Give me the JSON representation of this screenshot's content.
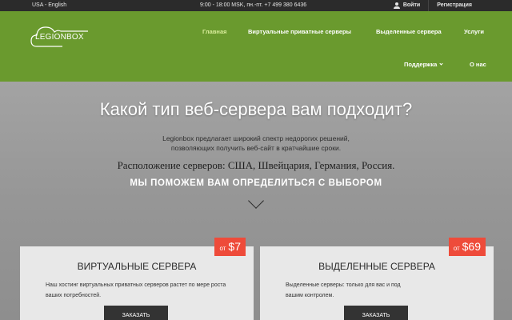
{
  "topbar": {
    "language": "USA - English",
    "hours": "9:00 - 18:00 MSK, пн.-пт.",
    "phone": "+7 499 380 6436",
    "login": "Войти",
    "register": "Регистрация"
  },
  "logo": {
    "text": "LEGIONBOX"
  },
  "nav": {
    "items": [
      {
        "label": "Главная"
      },
      {
        "label": "Виртуальные приватные серверы"
      },
      {
        "label": "Выделенные сервера"
      },
      {
        "label": "Услуги"
      },
      {
        "label": "Поддержка"
      },
      {
        "label": "О нас"
      }
    ]
  },
  "hero": {
    "title": "Какой тип веб-сервера вам подходит?",
    "description_line1": "Legionbox предлагает широкий спектр недорогих решений,",
    "description_line2": "позволяющих получить веб-сайт в кратчайшие сроки.",
    "locations": "Расположение серверов: США, Швейцария, Германия, Россия.",
    "help": "МЫ ПОМОЖЕМ ВАМ ОПРЕДЕЛИТЬСЯ С ВЫБОРОМ"
  },
  "cards": [
    {
      "price_prefix": "от",
      "price": "$7",
      "title": "ВИРТУАЛЬНЫЕ СЕРВЕРА",
      "text": "Наш хостинг виртуальных приватных серверов растет по мере роста ваших потребностей.",
      "button": "ЗАКАЗАТЬ"
    },
    {
      "price_prefix": "от",
      "price": "$69",
      "title": "ВЫДЕЛЕННЫЕ СЕРВЕРА",
      "text": "Выделенные серверы: только для вас и под вашим контролем.",
      "button": "ЗАКАЗАТЬ"
    }
  ],
  "colors": {
    "header_green": "#6a9a2e",
    "active_nav": "#d8ec9a",
    "price_red": "#ee4b3a",
    "topbar": "#2b2b2b"
  }
}
